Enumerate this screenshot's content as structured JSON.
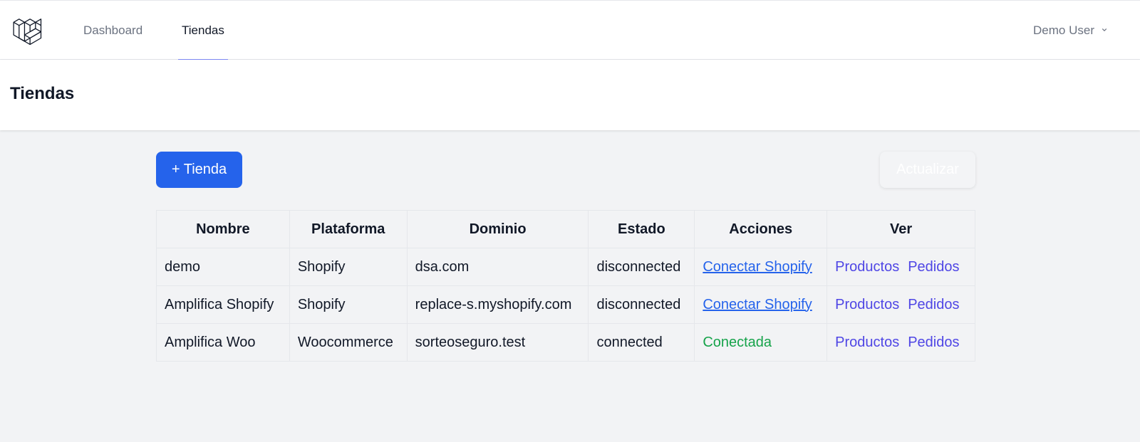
{
  "colors": {
    "primary": "#2563eb",
    "indigo": "#4f46e5",
    "active_tab": "#818cf8",
    "success": "#16a34a"
  },
  "nav": {
    "logo_icon": "laravel-logo-icon",
    "items": [
      {
        "label": "Dashboard",
        "active": false
      },
      {
        "label": "Tiendas",
        "active": true
      }
    ],
    "user": {
      "name": "Demo User",
      "icon": "chevron-down-icon"
    }
  },
  "header": {
    "title": "Tiendas"
  },
  "toolbar": {
    "add_label": "+ Tienda",
    "refresh_label": "Actualizar"
  },
  "table": {
    "columns": [
      "Nombre",
      "Plataforma",
      "Dominio",
      "Estado",
      "Acciones",
      "Ver"
    ],
    "rows": [
      {
        "nombre": "demo",
        "plataforma": "Shopify",
        "dominio": "dsa.com",
        "estado": "disconnected",
        "accion": "Conectar Shopify",
        "ver": [
          "Productos",
          "Pedidos"
        ]
      },
      {
        "nombre": "Amplifica Shopify",
        "plataforma": "Shopify",
        "dominio": "replace-s.myshopify.com",
        "estado": "disconnected",
        "accion": "Conectar Shopify",
        "ver": [
          "Productos",
          "Pedidos"
        ]
      },
      {
        "nombre": "Amplifica Woo",
        "plataforma": "Woocommerce",
        "dominio": "sorteoseguro.test",
        "estado": "connected",
        "accion": "Conectada",
        "ver": [
          "Productos",
          "Pedidos"
        ]
      }
    ]
  }
}
